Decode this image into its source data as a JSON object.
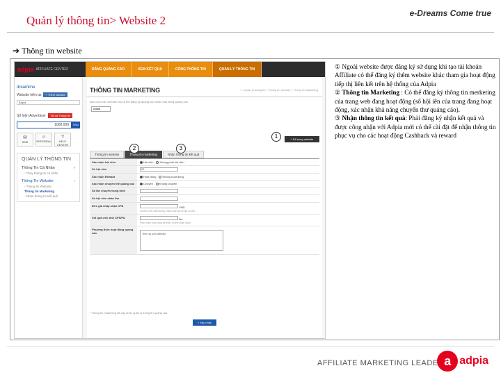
{
  "header": {
    "title": "Quản lý thông tin> Website 2",
    "brand": "e-Dreams Come true"
  },
  "section": {
    "arrow_icon": "arrow-right-icon",
    "title": "Thông tin website"
  },
  "screenshot": {
    "logo": "adpia",
    "logo_sub": "AFFILIATE CENTER",
    "menu": [
      "ĐĂNG QUẢNG CÁO",
      "XEM KẾT QUẢ",
      "CÔNG THÔNG TIN",
      "QUẢN LÝ THÔNG TIN"
    ],
    "sidebar": {
      "user": "dreamline",
      "site_label": "Website hiện tại",
      "site_button": "+ Thêm website",
      "site_value": "Adpia",
      "ads_label": "Số hiện Adverttiser",
      "ads_button": "Tất cả Thông tin",
      "balance_value": "1000 000",
      "balance_button": "VND",
      "icons": [
        {
          "icon": "mail-icon",
          "label": "SMS"
        },
        {
          "icon": "account-icon",
          "label": "REFERRAL"
        },
        {
          "icon": "help-icon",
          "label": "HELP CENTER"
        }
      ],
      "panel_title": "QUẢN LÝ THÔNG TIN",
      "panel_items": [
        {
          "label": "Thông Tin Cá Nhân",
          "level": 1,
          "active": false
        },
        {
          "label": "- Thay thông tin cá nhân",
          "level": 2,
          "active": false
        },
        {
          "label": "Thông Tin Website",
          "level": 1,
          "active": true
        },
        {
          "label": "- Thông tin Website",
          "level": 2,
          "active": false
        },
        {
          "label": "Thông tin Marketing",
          "level": 2,
          "active": true
        },
        {
          "label": "- Nhận thông tin kết quả",
          "level": 2,
          "active": false
        }
      ]
    },
    "main": {
      "title": "THÔNG TIN MARKETING",
      "breadcrumb": "> > Quản lý thông tin > Thông tin website > Thông tin Marketing",
      "hint": "Bạn chọn các website mà có thể đăng ký quảng cáo hoặc hoạt động quảng cáo",
      "select_value": "Adpia",
      "add_button": "+ Bổ sung website",
      "tabs": [
        "Thông tin website",
        "Thông tin marketing",
        "Nhận thông tin kết quả"
      ],
      "form": [
        {
          "label": "Xác nhận hội viên",
          "type": "radio",
          "options": [
            "Hội viên",
            "Không phải hội viên"
          ]
        },
        {
          "label": "Số hội viên",
          "type": "box",
          "value": "22"
        },
        {
          "label": "Xác nhận Reward",
          "type": "radio",
          "options": [
            "Hoạt động",
            "Không hoạt động"
          ]
        },
        {
          "label": "Xác nhận chuyên thể quảng cáo",
          "type": "radio",
          "options": [
            "Chuyên",
            "Không chuyên"
          ]
        },
        {
          "label": "Số lần chuyển trung bình",
          "type": "box",
          "value": ""
        },
        {
          "label": "Số hội viên nhân thu",
          "type": "box",
          "value": ""
        },
        {
          "label": "Đơn giá chấp nhận CPA",
          "type": "box",
          "value": "",
          "unit": "VND",
          "note": "Số tiền nhỏ nhất không chấp nhận được ghi có thể."
        },
        {
          "label": "Xét quả ước tính CPS/PA",
          "type": "box",
          "value": "",
          "unit": "lần",
          "note": "Phần trăm hoa hồng tối thiểu có thể chấp nhận."
        },
        {
          "label": "Phương thức hoạt động quảng cáo",
          "type": "text",
          "value": "Test ng  sửa affiliate"
        }
      ],
      "footer_note": "* Thông tin marketing đã cập nhật, quản lý thông tin quảng cáo.",
      "confirm": "+ Xác nhận"
    },
    "markers": [
      "1",
      "2",
      "3"
    ]
  },
  "notes": [
    {
      "num": "①",
      "bold": "",
      "text": " Ngoài website được đăng ký sử dụng khi tạo tài khoản Affiliate có thể đăng ký thêm website khác tham gia hoạt động tiếp thị liên kết trên hệ thống của Adpia"
    },
    {
      "num": "②",
      "bold": " Thông tin Marketing",
      "text": " : Có thể đăng ký thông tin merketing của trang web đang hoạt động (số hội iên của trang đang hoạt động, xác nhận khả năng chuyển thư quảng cáo)."
    },
    {
      "num": "③",
      "bold": " Nhận thông tin kết quả",
      "text": ": Phải đăng ký nhận kết quả và được công nhận với Adpia mới có thể cài đặt để nhận thông tin phục vụ cho các hoạt động Cashback và reward"
    }
  ],
  "footer": {
    "leader": "AFFILIATE MARKETING LEADER",
    "logo_mark": "a",
    "logo_text": "adpia"
  }
}
